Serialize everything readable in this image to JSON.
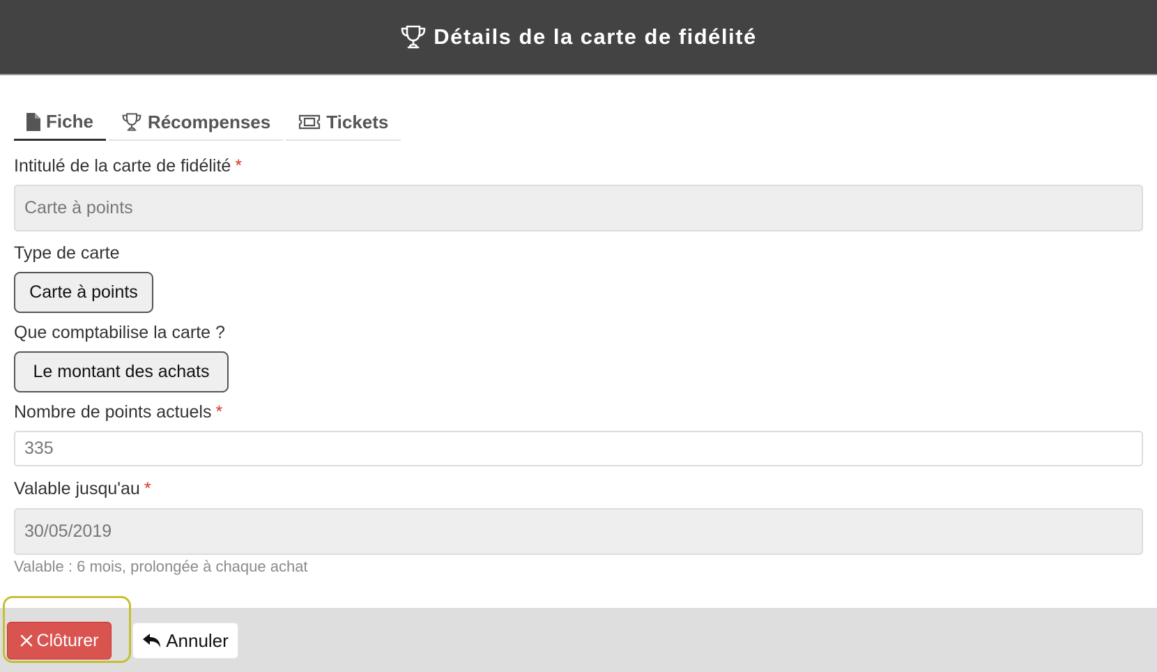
{
  "header": {
    "title": "Détails de la carte de fidélité",
    "icon": "trophy-icon"
  },
  "tabs": [
    {
      "label": "Fiche",
      "icon": "file-icon",
      "active": true
    },
    {
      "label": "Récompenses",
      "icon": "trophy-icon",
      "active": false
    },
    {
      "label": "Tickets",
      "icon": "ticket-icon",
      "active": false
    }
  ],
  "form": {
    "card_name": {
      "label": "Intitulé de la carte de fidélité",
      "required_mark": "*",
      "value": "Carte à points"
    },
    "card_type": {
      "label": "Type de carte",
      "value": "Carte à points"
    },
    "counting": {
      "label": "Que comptabilise la carte ?",
      "value": "Le montant des achats"
    },
    "points": {
      "label": "Nombre de points actuels",
      "required_mark": "*",
      "value": "335"
    },
    "valid_until": {
      "label": "Valable jusqu'au",
      "required_mark": "*",
      "value": "30/05/2019",
      "help": "Valable : 6 mois, prolongée à chaque achat"
    }
  },
  "footer": {
    "close_label": "Clôturer",
    "close_icon": "close-icon",
    "cancel_label": "Annuler",
    "cancel_icon": "undo-icon"
  },
  "colors": {
    "header_bg": "#434343",
    "danger": "#d9534f",
    "required": "#d9342b",
    "highlight": "#c3c034"
  }
}
